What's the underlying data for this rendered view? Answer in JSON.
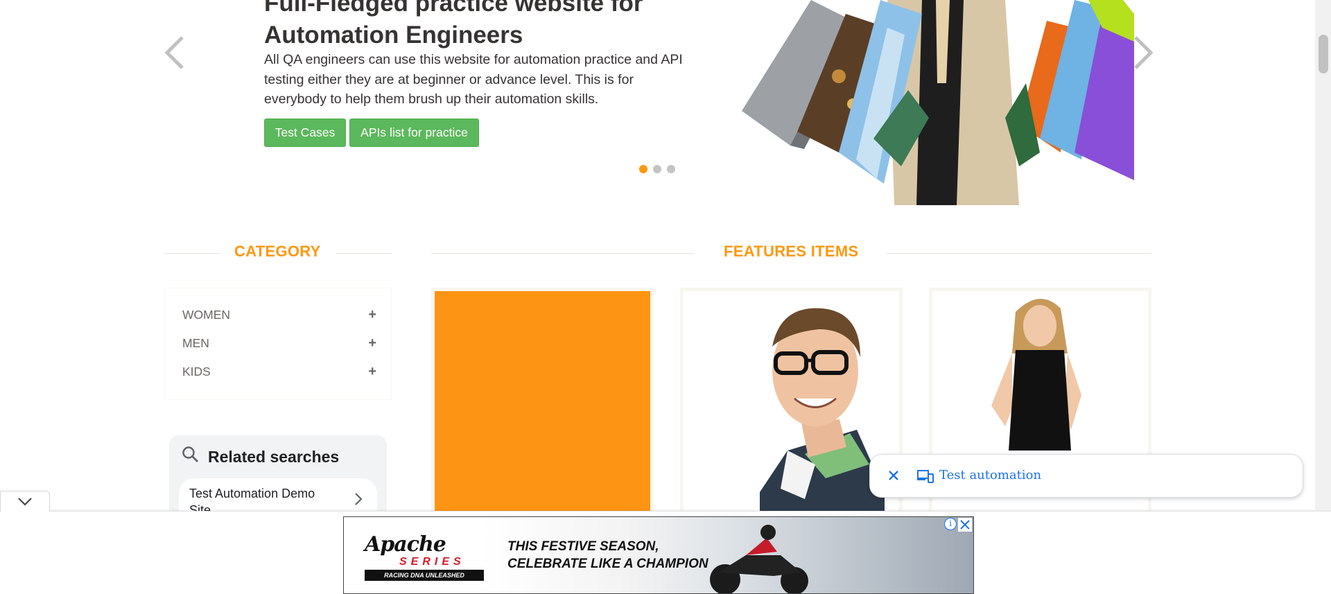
{
  "hero": {
    "title_line1": "Full-Fledged practice website for",
    "title_line2": "Automation Engineers",
    "description": "All QA engineers can use this website for automation practice and API testing either they are at beginner or advance level. This is for everybody to help them brush up their automation skills.",
    "buttons": {
      "test_cases": "Test Cases",
      "apis_list": "APIs list for practice"
    },
    "slide_indicator": {
      "total": 3,
      "active": 1
    }
  },
  "category": {
    "title": "CATEGORY",
    "items": [
      {
        "label": "WOMEN",
        "toggle": "+"
      },
      {
        "label": "MEN",
        "toggle": "+"
      },
      {
        "label": "KIDS",
        "toggle": "+"
      }
    ]
  },
  "features": {
    "title": "FEATURES ITEMS"
  },
  "related_searches": {
    "title": "Related searches",
    "items": [
      "Test Automation Demo Site"
    ]
  },
  "chip": {
    "text": "Test automation"
  },
  "ad": {
    "brand": "Apache",
    "series": "SERIES",
    "tagline": "RACING DNA UNLEASHED",
    "headline_line1": "THIS FESTIVE SEASON,",
    "headline_line2": "CELEBRATE LIKE A CHAMPION",
    "info_glyph": "i"
  },
  "colors": {
    "accent_orange": "#fe980f",
    "button_green": "#5cb85c",
    "link_blue": "#1a73e8"
  }
}
